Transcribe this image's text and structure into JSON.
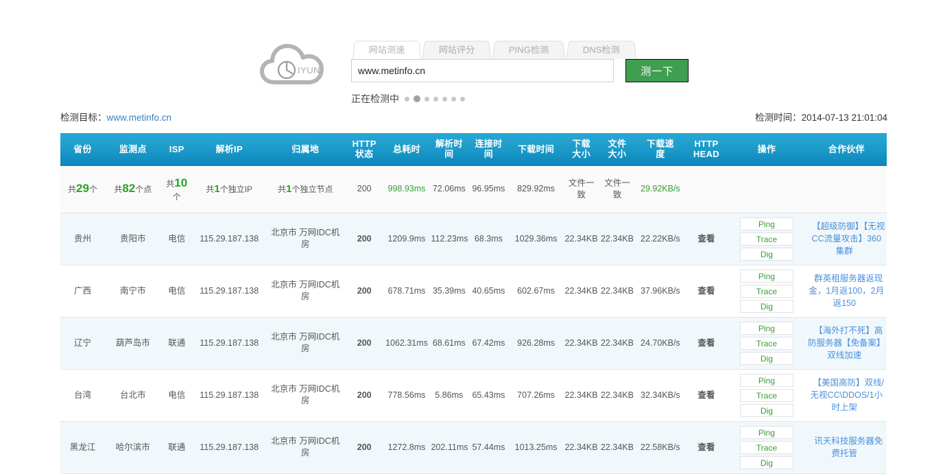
{
  "brand": {
    "logo_text": "IYUN"
  },
  "tabs": [
    {
      "label": "网站测速",
      "active": true
    },
    {
      "label": "网站评分",
      "active": false
    },
    {
      "label": "PING检测",
      "active": false
    },
    {
      "label": "DNS检测",
      "active": false
    }
  ],
  "search": {
    "value": "www.metinfo.cn",
    "placeholder": "www.metinfo.cn",
    "button_label": "测一下"
  },
  "status": {
    "loading_text": "正在检测中",
    "dots_total": 7,
    "dot_active_index": 1
  },
  "meta": {
    "target_label": "检测目标：",
    "target_url": "www.metinfo.cn",
    "time_label": "检测时间：",
    "time_value": "2014-07-13 21:01:04"
  },
  "table": {
    "headers": [
      "省份",
      "监测点",
      "ISP",
      "解析IP",
      "归属地",
      "HTTP\n状态",
      "总耗时",
      "解析时间",
      "连接时间",
      "下载时间",
      "下载\n大小",
      "文件\n大小",
      "下载速度",
      "HTTP\nHEAD",
      "操作",
      "合作伙伴"
    ],
    "headers_flat": [
      "省份",
      "监测点",
      "ISP",
      "解析IP",
      "归属地",
      "HTTP 状态",
      "总耗时",
      "解析时间",
      "连接时间",
      "下载时间",
      "下载大小",
      "文件大小",
      "下载速度",
      "HTTP HEAD",
      "操作",
      "合作伙伴"
    ],
    "summary": {
      "province_prefix": "共",
      "province_num": "29",
      "province_suffix": "个",
      "node_prefix": "共",
      "node_num": "82",
      "node_suffix": "个点",
      "isp_prefix": "共",
      "isp_num": "10",
      "isp_suffix": "个",
      "ip_prefix": "共",
      "ip_num": "1",
      "ip_suffix": "个独立IP",
      "loc_prefix": "共",
      "loc_num": "1",
      "loc_suffix": "个独立节点",
      "http_status": "200",
      "total_time": "998.93ms",
      "resolve_time": "72.06ms",
      "connect_time": "96.95ms",
      "download_time": "829.92ms",
      "download_size": "文件一致",
      "file_size": "文件一致",
      "speed": "29.92KB/s",
      "http_head": "",
      "ops": "",
      "partner": ""
    },
    "rows": [
      {
        "province": "贵州",
        "node": "贵阳市",
        "isp": "电信",
        "ip": "115.29.187.138",
        "location": "北京市 万网IDC机房",
        "http_status": "200",
        "total_time": "1209.9ms",
        "total_time_level": "orange",
        "resolve_time": "112.23ms",
        "connect_time": "68.3ms",
        "download_time": "1029.36ms",
        "download_size": "22.34KB",
        "file_size": "22.34KB",
        "speed": "22.22KB/s",
        "http_head": "查看",
        "ops": [
          "Ping",
          "Trace",
          "Dig"
        ],
        "partner": "【超级防御】【无视CC流量攻击】360集群"
      },
      {
        "province": "广西",
        "node": "南宁市",
        "isp": "电信",
        "ip": "115.29.187.138",
        "location": "北京市 万网IDC机房",
        "http_status": "200",
        "total_time": "678.71ms",
        "total_time_level": "green",
        "resolve_time": "35.39ms",
        "connect_time": "40.65ms",
        "download_time": "602.67ms",
        "download_size": "22.34KB",
        "file_size": "22.34KB",
        "speed": "37.96KB/s",
        "http_head": "查看",
        "ops": [
          "Ping",
          "Trace",
          "Dig"
        ],
        "partner": "群英租服务器返现金，1月返100，2月返150"
      },
      {
        "province": "辽宁",
        "node": "葫芦岛市",
        "isp": "联通",
        "ip": "115.29.187.138",
        "location": "北京市 万网IDC机房",
        "http_status": "200",
        "total_time": "1062.31ms",
        "total_time_level": "orange",
        "resolve_time": "68.61ms",
        "connect_time": "67.42ms",
        "download_time": "926.28ms",
        "download_size": "22.34KB",
        "file_size": "22.34KB",
        "speed": "24.70KB/s",
        "http_head": "查看",
        "ops": [
          "Ping",
          "Trace",
          "Dig"
        ],
        "partner": "【海外打不死】高防服务器【免备案】双线加速"
      },
      {
        "province": "台湾",
        "node": "台北市",
        "isp": "电信",
        "ip": "115.29.187.138",
        "location": "北京市 万网IDC机房",
        "http_status": "200",
        "total_time": "778.56ms",
        "total_time_level": "green",
        "resolve_time": "5.86ms",
        "connect_time": "65.43ms",
        "download_time": "707.26ms",
        "download_size": "22.34KB",
        "file_size": "22.34KB",
        "speed": "32.34KB/s",
        "http_head": "查看",
        "ops": [
          "Ping",
          "Trace",
          "Dig"
        ],
        "partner": "【美国高防】双线/无视CC\\DDOS/1小时上架"
      },
      {
        "province": "黑龙江",
        "node": "哈尔滨市",
        "isp": "联通",
        "ip": "115.29.187.138",
        "location": "北京市 万网IDC机房",
        "http_status": "200",
        "total_time": "1272.8ms",
        "total_time_level": "orange",
        "resolve_time": "202.11ms",
        "connect_time": "57.44ms",
        "download_time": "1013.25ms",
        "download_size": "22.34KB",
        "file_size": "22.34KB",
        "speed": "22.58KB/s",
        "http_head": "查看",
        "ops": [
          "Ping",
          "Trace",
          "Dig"
        ],
        "partner": "讯天科技服务器免费托管"
      }
    ]
  },
  "colors": {
    "header_blue": "#1d9ccb",
    "accent_green": "#27a327",
    "button_green": "#3f9e4f",
    "link_blue": "#4a90d9",
    "speed_orange": "#f4511e",
    "warn_orange": "#f0a30a",
    "fast_green": "#32cd32",
    "file_red": "#c0392b"
  }
}
